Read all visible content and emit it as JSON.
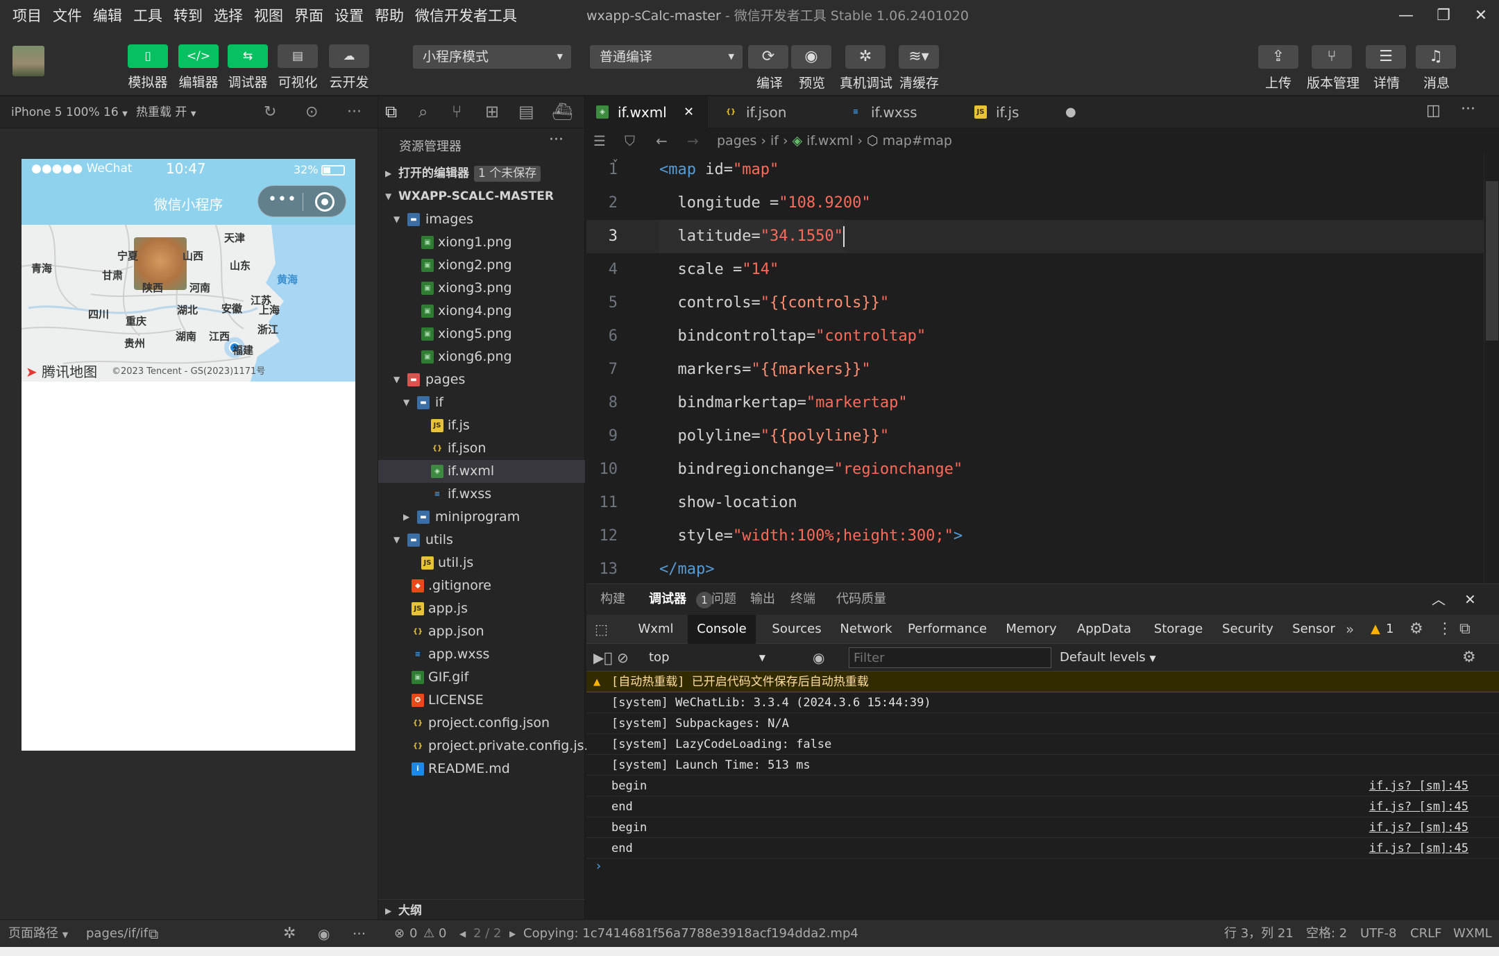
{
  "menubar": {
    "items": [
      "项目",
      "文件",
      "编辑",
      "工具",
      "转到",
      "选择",
      "视图",
      "界面",
      "设置",
      "帮助",
      "微信开发者工具"
    ],
    "title_project": "wxapp-sCalc-master",
    "title_app": " - 微信开发者工具 Stable 1.06.2401020"
  },
  "toolbar": {
    "simulator": "模拟器",
    "editor": "编辑器",
    "debugger": "调试器",
    "visual": "可视化",
    "cloud": "云开发",
    "mode_select": "小程序模式",
    "compile_select": "普通编译",
    "compile": "编译",
    "preview": "预览",
    "remote_debug": "真机调试",
    "clear_cache": "清缓存",
    "upload": "上传",
    "version": "版本管理",
    "details": "详情",
    "messages": "消息"
  },
  "simulator": {
    "device": "iPhone 5 100% 16",
    "hot_reload": "热重载 开",
    "status_carrier": "●●●●● WeChat",
    "status_time": "10:47",
    "status_battery": "32%",
    "nav_title": "微信小程序",
    "map_labels": [
      "天津",
      "青海",
      "宁夏",
      "山西",
      "山东",
      "甘肃",
      "陕西",
      "河南",
      "黄海",
      "江苏",
      "四川",
      "湖北",
      "安徽",
      "上海",
      "重庆",
      "浙江",
      "湖南",
      "江西",
      "贵州",
      "福建"
    ],
    "map_logo": "腾讯地图",
    "map_copyright": "©2023 Tencent - GS(2023)1171号"
  },
  "explorer": {
    "title": "资源管理器",
    "open_editors": "打开的编辑器",
    "unsaved": "1 个未保存",
    "project": "WXAPP-SCALC-MASTER",
    "outline": "大纲",
    "tree": [
      {
        "name": "images",
        "type": "folder",
        "depth": 1,
        "open": true
      },
      {
        "name": "xiong1.png",
        "type": "img",
        "depth": 2
      },
      {
        "name": "xiong2.png",
        "type": "img",
        "depth": 2
      },
      {
        "name": "xiong3.png",
        "type": "img",
        "depth": 2
      },
      {
        "name": "xiong4.png",
        "type": "img",
        "depth": 2
      },
      {
        "name": "xiong5.png",
        "type": "img",
        "depth": 2
      },
      {
        "name": "xiong6.png",
        "type": "img",
        "depth": 2
      },
      {
        "name": "pages",
        "type": "folder-red",
        "depth": 1,
        "open": true
      },
      {
        "name": "if",
        "type": "folder",
        "depth": 2,
        "open": true
      },
      {
        "name": "if.js",
        "type": "js",
        "depth": 3
      },
      {
        "name": "if.json",
        "type": "json",
        "depth": 3
      },
      {
        "name": "if.wxml",
        "type": "wxml",
        "depth": 3,
        "selected": true
      },
      {
        "name": "if.wxss",
        "type": "wxss",
        "depth": 3
      },
      {
        "name": "miniprogram",
        "type": "folder",
        "depth": 2,
        "open": false
      },
      {
        "name": "utils",
        "type": "folder",
        "depth": 1,
        "open": true
      },
      {
        "name": "util.js",
        "type": "js",
        "depth": 2
      },
      {
        "name": ".gitignore",
        "type": "git",
        "depth": 1
      },
      {
        "name": "app.js",
        "type": "js",
        "depth": 1
      },
      {
        "name": "app.json",
        "type": "json",
        "depth": 1
      },
      {
        "name": "app.wxss",
        "type": "wxss",
        "depth": 1
      },
      {
        "name": "GIF.gif",
        "type": "img",
        "depth": 1
      },
      {
        "name": "LICENSE",
        "type": "license",
        "depth": 1
      },
      {
        "name": "project.config.json",
        "type": "json",
        "depth": 1
      },
      {
        "name": "project.private.config.js...",
        "type": "json",
        "depth": 1
      },
      {
        "name": "README.md",
        "type": "info",
        "depth": 1
      }
    ]
  },
  "editor": {
    "tabs": [
      {
        "name": "if.wxml",
        "type": "wxml",
        "active": true
      },
      {
        "name": "if.json",
        "type": "json"
      },
      {
        "name": "if.wxss",
        "type": "wxss"
      },
      {
        "name": "if.js",
        "type": "js",
        "dirty": true
      }
    ],
    "breadcrumb": [
      "pages",
      "if",
      "if.wxml",
      "map#map"
    ],
    "lines": [
      {
        "n": "1",
        "parts": [
          [
            "tag",
            "<map "
          ],
          [
            "at",
            "id="
          ],
          [
            "str",
            "\"map\""
          ]
        ]
      },
      {
        "n": "2",
        "parts": [
          [
            "at",
            "  longitude ="
          ],
          [
            "str",
            "\"108.9200\""
          ]
        ]
      },
      {
        "n": "3",
        "parts": [
          [
            "at",
            "  latitude="
          ],
          [
            "str",
            "\"34.1550\""
          ]
        ],
        "current": true
      },
      {
        "n": "4",
        "parts": [
          [
            "at",
            "  scale ="
          ],
          [
            "str",
            "\"14\""
          ]
        ]
      },
      {
        "n": "5",
        "parts": [
          [
            "at",
            "  controls="
          ],
          [
            "str",
            "\""
          ],
          [
            "brc",
            "{{controls}}"
          ],
          [
            "str",
            "\""
          ]
        ]
      },
      {
        "n": "6",
        "parts": [
          [
            "at",
            "  bindcontroltap="
          ],
          [
            "str",
            "\"controltap\""
          ]
        ]
      },
      {
        "n": "7",
        "parts": [
          [
            "at",
            "  markers="
          ],
          [
            "str",
            "\""
          ],
          [
            "brc",
            "{{markers}}"
          ],
          [
            "str",
            "\""
          ]
        ]
      },
      {
        "n": "8",
        "parts": [
          [
            "at",
            "  bindmarkertap="
          ],
          [
            "str",
            "\"markertap\""
          ]
        ]
      },
      {
        "n": "9",
        "parts": [
          [
            "at",
            "  polyline="
          ],
          [
            "str",
            "\""
          ],
          [
            "brc",
            "{{polyline}}"
          ],
          [
            "str",
            "\""
          ]
        ]
      },
      {
        "n": "10",
        "parts": [
          [
            "at",
            "  bindregionchange="
          ],
          [
            "str",
            "\"regionchange\""
          ]
        ]
      },
      {
        "n": "11",
        "parts": [
          [
            "at",
            "  show-location"
          ]
        ]
      },
      {
        "n": "12",
        "parts": [
          [
            "at",
            "  style="
          ],
          [
            "str",
            "\"width:100%;height:300;\""
          ],
          [
            "tag",
            ">"
          ]
        ]
      },
      {
        "n": "13",
        "parts": [
          [
            "tag",
            "</map>"
          ]
        ]
      }
    ]
  },
  "panel": {
    "tabs": [
      "构建",
      "调试器",
      "问题",
      "输出",
      "终端",
      "代码质量"
    ],
    "debugger_badge": "1",
    "devtools_tabs": [
      "Wxml",
      "Console",
      "Sources",
      "Network",
      "Performance",
      "Memory",
      "AppData",
      "Storage",
      "Security",
      "Sensor"
    ],
    "warn_count": "1",
    "context": "top",
    "filter_placeholder": "Filter",
    "levels": "Default levels",
    "logs": [
      {
        "text": "[自动热重载] 已开启代码文件保存后自动热重载",
        "level": "warn"
      },
      {
        "text": "[system] WeChatLib: 3.3.4 (2024.3.6 15:44:39)"
      },
      {
        "text": "[system] Subpackages: N/A"
      },
      {
        "text": "[system] LazyCodeLoading: false"
      },
      {
        "text": "[system] Launch Time: 513 ms"
      },
      {
        "text": "begin",
        "src": "if.js? [sm]:45"
      },
      {
        "text": "end",
        "src": "if.js? [sm]:45"
      },
      {
        "text": "begin",
        "src": "if.js? [sm]:45"
      },
      {
        "text": "end",
        "src": "if.js? [sm]:45"
      }
    ]
  },
  "statusbar": {
    "page_path_label": "页面路径",
    "page_path": "pages/if/if",
    "errors": "0",
    "warnings": "0",
    "nav": "2 / 2",
    "copying": "Copying: 1c7414681f56a7788e3918acf194dda2.mp4",
    "cursor": "行 3，列 21",
    "spaces": "空格: 2",
    "encoding": "UTF-8",
    "eol": "CRLF",
    "lang": "WXML"
  }
}
